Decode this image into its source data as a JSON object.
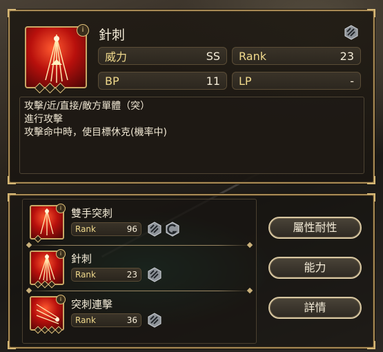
{
  "selected_skill": {
    "name": "針刺",
    "icon": "needle-stab-skill-icon",
    "rank_badge_icon": "rank-circle-icon",
    "type_icon": "pierce-type-icon",
    "stats": {
      "power_label": "威力",
      "power_value": "SS",
      "rank_label": "Rank",
      "rank_value": "23",
      "bp_label": "BP",
      "bp_value": "11",
      "lp_label": "LP",
      "lp_value": "-"
    },
    "description": {
      "line1": "攻擊/近/直接/敵方單體（突）",
      "line2": "進行攻擊",
      "line3": "攻擊命中時，使目標休克(機率中)"
    }
  },
  "skill_list": [
    {
      "name": "雙手突刺",
      "rank_label": "Rank",
      "rank_value": "96",
      "icon": "two-hand-thrust-skill-icon",
      "type_icons": [
        "pierce-type-icon",
        "reinforced-type-icon"
      ]
    },
    {
      "name": "針刺",
      "rank_label": "Rank",
      "rank_value": "23",
      "icon": "needle-stab-skill-icon",
      "type_icons": [
        "pierce-type-icon"
      ]
    },
    {
      "name": "突刺連擊",
      "rank_label": "Rank",
      "rank_value": "36",
      "icon": "thrust-combo-skill-icon",
      "type_icons": [
        "pierce-type-icon"
      ]
    }
  ],
  "buttons": {
    "attribute_resistance": "屬性耐性",
    "abilities": "能力",
    "details": "詳情"
  },
  "colors": {
    "accent_gold": "#c9a866",
    "label_gold": "#f0d98c",
    "skill_icon_red": "#b8100c"
  }
}
